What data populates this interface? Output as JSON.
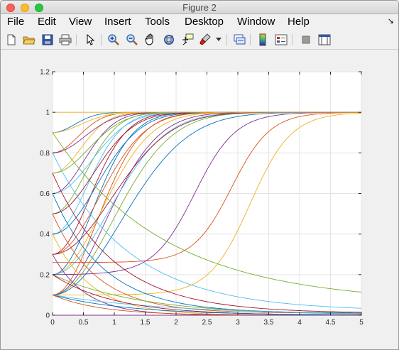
{
  "window": {
    "title": "Figure 2"
  },
  "menu": [
    "File",
    "Edit",
    "View",
    "Insert",
    "Tools",
    "Desktop",
    "Window",
    "Help"
  ],
  "toolbar": {
    "icons": [
      "new-figure-icon",
      "open-file-icon",
      "save-icon",
      "print-icon",
      "edit-plot-icon",
      "zoom-in-icon",
      "zoom-out-icon",
      "pan-icon",
      "rotate-3d-icon",
      "data-cursor-icon",
      "brush-icon",
      "link-plot-icon",
      "colorbar-icon",
      "legend-icon",
      "hide-plot-tools-icon",
      "show-plot-tools-icon"
    ]
  },
  "chart_data": {
    "type": "line",
    "title": "",
    "xlabel": "",
    "ylabel": "",
    "xlim": [
      0,
      5
    ],
    "ylim": [
      0,
      1.2
    ],
    "xticks": [
      "0",
      "0.5",
      "1",
      "1.5",
      "2",
      "2.5",
      "3",
      "3.5",
      "4",
      "4.5",
      "5"
    ],
    "yticks": [
      "0",
      "0.2",
      "0.4",
      "0.6",
      "0.8",
      "1",
      "1.2"
    ],
    "grid": true,
    "colors": [
      "#0072bd",
      "#d95319",
      "#edb120",
      "#7e2f8e",
      "#77ac30",
      "#4dbeee",
      "#a2142f"
    ],
    "series": [
      {
        "y0": 0.9,
        "y_end": 1.0,
        "shape": "rise",
        "rate": 4.0
      },
      {
        "y0": 0.8,
        "y_end": 1.0,
        "shape": "rise",
        "rate": 3.0
      },
      {
        "y0": 0.7,
        "y_end": 1.0,
        "shape": "rise",
        "rate": 2.5
      },
      {
        "y0": 0.6,
        "y_end": 1.0,
        "shape": "rise",
        "rate": 2.0
      },
      {
        "y0": 0.5,
        "y_end": 1.0,
        "shape": "rise",
        "rate": 1.8
      },
      {
        "y0": 0.4,
        "y_end": 1.0,
        "shape": "rise",
        "rate": 1.6
      },
      {
        "y0": 0.3,
        "y_end": 1.0,
        "shape": "rise",
        "rate": 1.4
      },
      {
        "y0": 0.2,
        "y_end": 1.0,
        "shape": "rise",
        "rate": 1.2
      },
      {
        "y0": 0.1,
        "y_end": 1.0,
        "shape": "rise",
        "rate": 1.0
      },
      {
        "y0": 0.9,
        "y_end": 1.0,
        "shape": "rise",
        "rate": 2.5
      },
      {
        "y0": 0.8,
        "y_end": 1.0,
        "shape": "rise",
        "rate": 1.9
      },
      {
        "y0": 0.7,
        "y_end": 1.0,
        "shape": "rise",
        "rate": 1.5
      },
      {
        "y0": 0.6,
        "y_end": 1.0,
        "shape": "rise",
        "rate": 1.3
      },
      {
        "y0": 0.5,
        "y_end": 1.0,
        "shape": "rise",
        "rate": 1.15
      },
      {
        "y0": 0.4,
        "y_end": 1.0,
        "shape": "rise",
        "rate": 1.0
      },
      {
        "y0": 0.3,
        "y_end": 1.0,
        "shape": "rise",
        "rate": 0.9
      },
      {
        "y0": 0.2,
        "y_end": 1.0,
        "shape": "rise",
        "rate": 0.8
      },
      {
        "y0": 0.1,
        "y_end": 1.0,
        "shape": "rise",
        "rate": 0.7
      },
      {
        "y0": 0.1,
        "y_end": 1.0,
        "shape": "rise",
        "rate": 0.55
      },
      {
        "y0": 0.2,
        "y_end": 1.0,
        "shape": "rise",
        "rate": 0.6
      },
      {
        "y0": 0.3,
        "y_end": 1.0,
        "shape": "rise",
        "rate": 0.55
      },
      {
        "y0": 0.1,
        "y_end": 1.0,
        "shape": "rise",
        "rate": 0.42
      },
      {
        "y0": 0.26,
        "y_end": 1.0,
        "shape": "sigmoid",
        "mid": 2.9,
        "k": 3.2
      },
      {
        "y0": 0.1,
        "y_end": 1.0,
        "shape": "sigmoid",
        "mid": 3.2,
        "k": 3.0
      },
      {
        "y0": 0.2,
        "y_end": 1.0,
        "shape": "sigmoid",
        "mid": 2.3,
        "k": 3.0
      },
      {
        "y0": 0.9,
        "y_end": 0.06,
        "shape": "decay",
        "rate": 0.55
      },
      {
        "y0": 0.8,
        "y_end": 0.02,
        "shape": "decay",
        "rate": 0.8
      },
      {
        "y0": 0.7,
        "y_end": 0.01,
        "shape": "decay",
        "rate": 1.0
      },
      {
        "y0": 0.6,
        "y_end": 0.01,
        "shape": "decay",
        "rate": 1.2
      },
      {
        "y0": 0.5,
        "y_end": 0.01,
        "shape": "decay",
        "rate": 1.4
      },
      {
        "y0": 0.4,
        "y_end": 0.0,
        "shape": "decay",
        "rate": 1.6
      },
      {
        "y0": 0.3,
        "y_end": 0.0,
        "shape": "decay",
        "rate": 1.9
      },
      {
        "y0": 0.2,
        "y_end": 0.0,
        "shape": "decay",
        "rate": 0.7
      },
      {
        "y0": 0.1,
        "y_end": 0.0,
        "shape": "decay",
        "rate": 0.5
      },
      {
        "y0": 0.2,
        "y_end": 0.0,
        "shape": "decay",
        "rate": 1.0
      },
      {
        "y0": 0.1,
        "y_end": 0.0,
        "shape": "decay",
        "rate": 0.8
      },
      {
        "y0": 0.1,
        "y_end": 0.0,
        "shape": "decay",
        "rate": 1.3
      },
      {
        "y0": 1.0,
        "y_end": 1.0,
        "shape": "flat"
      },
      {
        "y0": 0.0,
        "y_end": 0.0,
        "shape": "flat"
      }
    ]
  }
}
